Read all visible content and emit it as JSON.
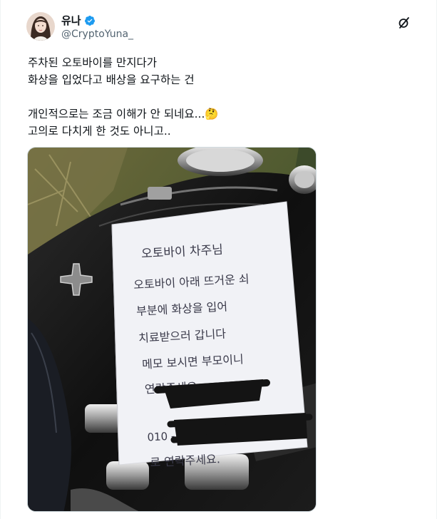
{
  "author": {
    "display_name": "유나",
    "handle": "@CryptoYuna_",
    "verified": true,
    "avatar": "profile-photo"
  },
  "actions": {
    "grok_icon": "grok-slash-icon"
  },
  "tweet": {
    "text": "주차된 오토바이를 만지다가\n화상을 입었다고 배상을 요구하는 건\n\n개인적으로는 조금 이해가 안 되네요...🤔\n고의로 다치게 한 것도 아니고.."
  },
  "note": {
    "line1": "오토바이 차주님",
    "line2": "오토바이 아래 뜨거운 쇠",
    "line3": "부분에 화상을 입어",
    "line4": "치료받으러 갑니다",
    "line5": "메모 보시면 부모이니",
    "line6": "연락주세요.",
    "line7": "010 -",
    "line8": "로 연락주세요."
  },
  "colors": {
    "verified_blue": "#1d9bf0",
    "text_primary": "#0f1419",
    "text_secondary": "#536471"
  }
}
